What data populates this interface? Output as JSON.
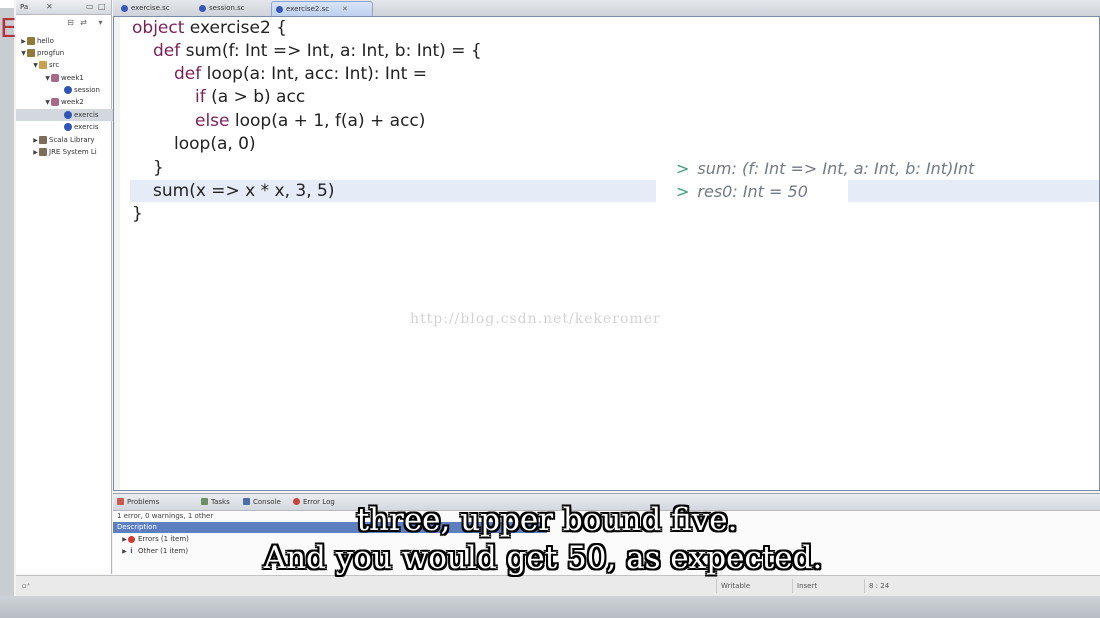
{
  "explorer": {
    "tab_label": "Pa",
    "tree": [
      {
        "label": "hello",
        "icon": "project-icon"
      },
      {
        "label": "progfun",
        "icon": "project-icon"
      },
      {
        "label": "src",
        "icon": "source-folder-icon"
      },
      {
        "label": "week1",
        "icon": "package-icon"
      },
      {
        "label": "session",
        "icon": "scala-file-icon"
      },
      {
        "label": "week2",
        "icon": "package-icon"
      },
      {
        "label": "exercis",
        "icon": "scala-file-icon"
      },
      {
        "label": "exercis",
        "icon": "scala-file-icon"
      },
      {
        "label": "Scala Library",
        "icon": "library-icon"
      },
      {
        "label": "JRE System Li",
        "icon": "library-icon"
      }
    ]
  },
  "editor_tabs": [
    {
      "label": "exercise.sc"
    },
    {
      "label": "session.sc"
    },
    {
      "label": "exercise2.sc",
      "active": true
    }
  ],
  "code_lines": [
    {
      "kw": "object",
      "rest": " exercise2 {"
    },
    {
      "kw": "def",
      "rest": " sum(f: Int => Int, a: Int, b: Int) = {"
    },
    {
      "kw": "def",
      "rest": " loop(a: Int, acc: Int): Int ="
    },
    {
      "kw": "if",
      "rest": " (a > b) acc"
    },
    {
      "kw": "else",
      "rest": " loop(a + 1, f(a) + acc)"
    },
    {
      "kw": "",
      "rest": "loop(a, 0)"
    },
    {
      "kw": "",
      "rest": "}"
    },
    {
      "kw": "",
      "rest": "sum(x => x * x, 3, 5)"
    },
    {
      "kw": "",
      "rest": "}"
    }
  ],
  "worksheet_results": [
    {
      "prompt": ">",
      "text": "sum: (f: Int => Int, a: Int, b: Int)Int"
    },
    {
      "prompt": ">",
      "text": "res0: Int = 50"
    }
  ],
  "watermark": "http://blog.csdn.net/kekeromer",
  "problems": {
    "tabs": [
      "Problems",
      "Tasks",
      "Console",
      "Error Log"
    ],
    "summary": "1 error, 0 warnings, 1 other",
    "column": "Description",
    "rows": [
      "Errors (1 item)",
      "Other (1 item)"
    ]
  },
  "status": {
    "writable": "Writable",
    "insert_mode": "Insert",
    "position": "8 : 24"
  },
  "subtitles": [
    "three, upper bound five.",
    "And you would get 50, as expected."
  ],
  "colors": {
    "keyword": "#7b1f57",
    "worksheet_prompt": "#3e9e75",
    "selection": "#e6ecf7"
  }
}
